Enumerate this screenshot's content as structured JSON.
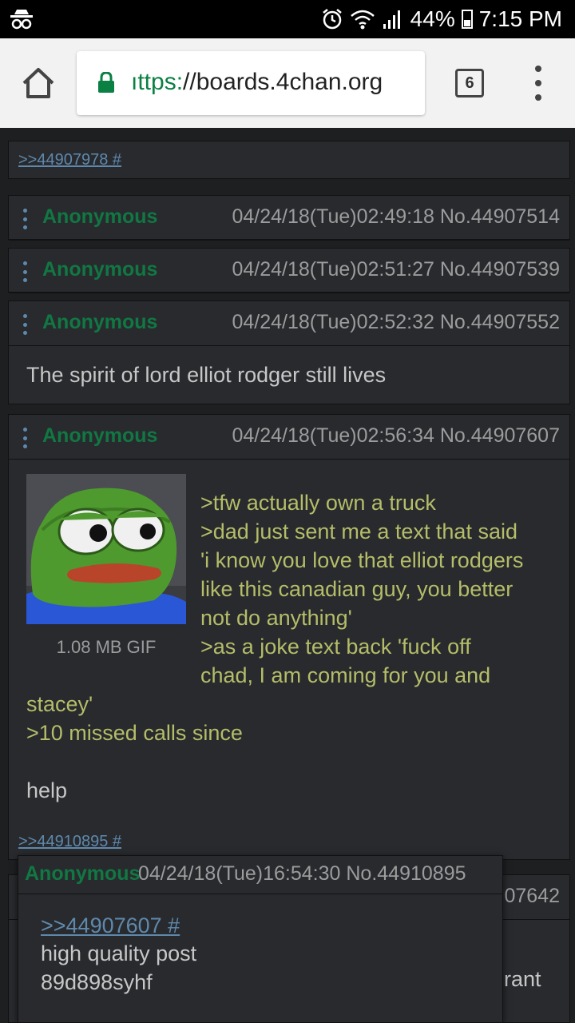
{
  "status_bar": {
    "battery": "44%",
    "time": "7:15 PM",
    "icons": [
      "incognito-icon",
      "alarm-icon",
      "wifi-icon",
      "signal-icon",
      "battery-icon"
    ]
  },
  "browser": {
    "url_scheme": "https://",
    "url_scheme_visible": "ıttps:",
    "url_rest": "//boards.4chan.org",
    "tab_count": "6"
  },
  "top_ref": ">>44907978 #",
  "posts": [
    {
      "name": "Anonymous",
      "meta": "04/24/18(Tue)02:49:18 No.44907514"
    },
    {
      "name": "Anonymous",
      "meta": "04/24/18(Tue)02:51:27 No.44907539"
    },
    {
      "name": "Anonymous",
      "meta": "04/24/18(Tue)02:52:32 No.44907552",
      "body": "The spirit of lord elliot rodger still lives"
    },
    {
      "name": "Anonymous",
      "meta": "04/24/18(Tue)02:56:34 No.44907607",
      "file_info": "1.08 MB GIF",
      "lines": [
        ">tfw actually own a truck",
        ">dad just sent me a text that said",
        "'i know you love that elliot rodgers",
        "like this canadian guy, you better",
        "not do anything'",
        ">as a joke text back 'fuck off",
        "chad, I am coming for you and",
        "stacey'",
        ">10 missed calls since",
        "help"
      ],
      "reply_ref": ">>44910895 #"
    }
  ],
  "hidden_post": {
    "meta_fragment": "07642",
    "body_fragment": "rant"
  },
  "popup": {
    "name": "Anonymous",
    "meta": "04/24/18(Tue)16:54:30 No.44910895",
    "quote": ">>44907607 #",
    "line1": "high quality post",
    "line2": "89d898syhf"
  },
  "colors": {
    "name": "#117743",
    "greentext": "#b5bd68",
    "quotelink": "#5f89ac",
    "body": "#c5c8c6",
    "panel": "#282a2e",
    "background": "#1d1f21"
  }
}
